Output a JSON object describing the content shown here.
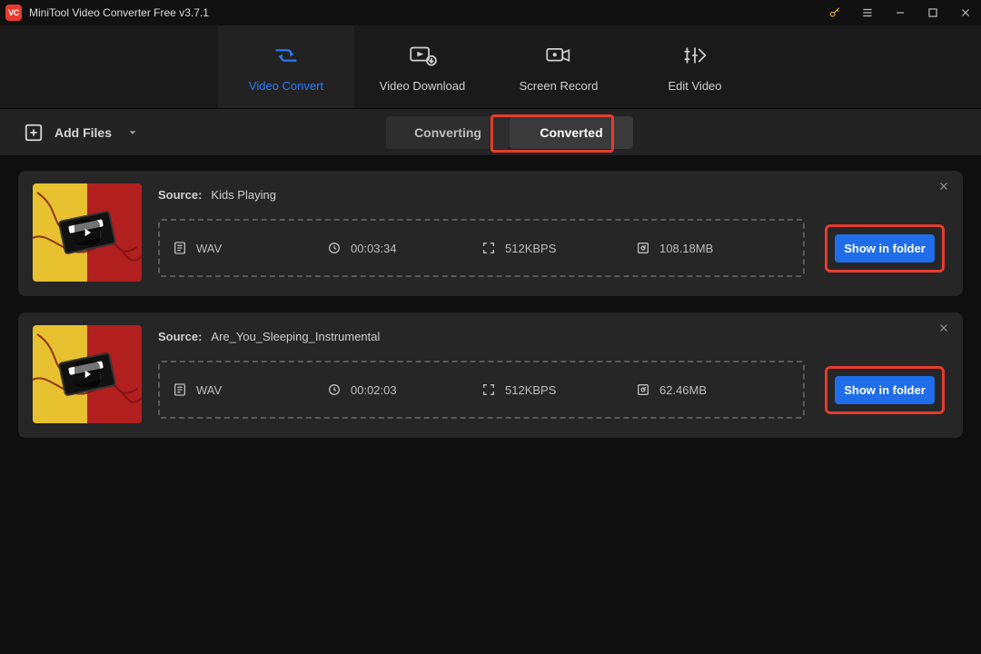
{
  "app": {
    "title": "MiniTool Video Converter Free v3.7.1"
  },
  "nav": {
    "video_convert": "Video Convert",
    "video_download": "Video Download",
    "screen_record": "Screen Record",
    "edit_video": "Edit Video"
  },
  "toolbar": {
    "add_files": "Add Files",
    "converting": "Converting",
    "converted": "Converted"
  },
  "items": [
    {
      "source_label": "Source:",
      "source_name": "Kids Playing",
      "format": "WAV",
      "duration": "00:03:34",
      "bitrate": "512KBPS",
      "filesize": "108.18MB",
      "show_in_folder": "Show in folder"
    },
    {
      "source_label": "Source:",
      "source_name": "Are_You_Sleeping_Instrumental",
      "format": "WAV",
      "duration": "00:02:03",
      "bitrate": "512KBPS",
      "filesize": "62.46MB",
      "show_in_folder": "Show in folder"
    }
  ]
}
